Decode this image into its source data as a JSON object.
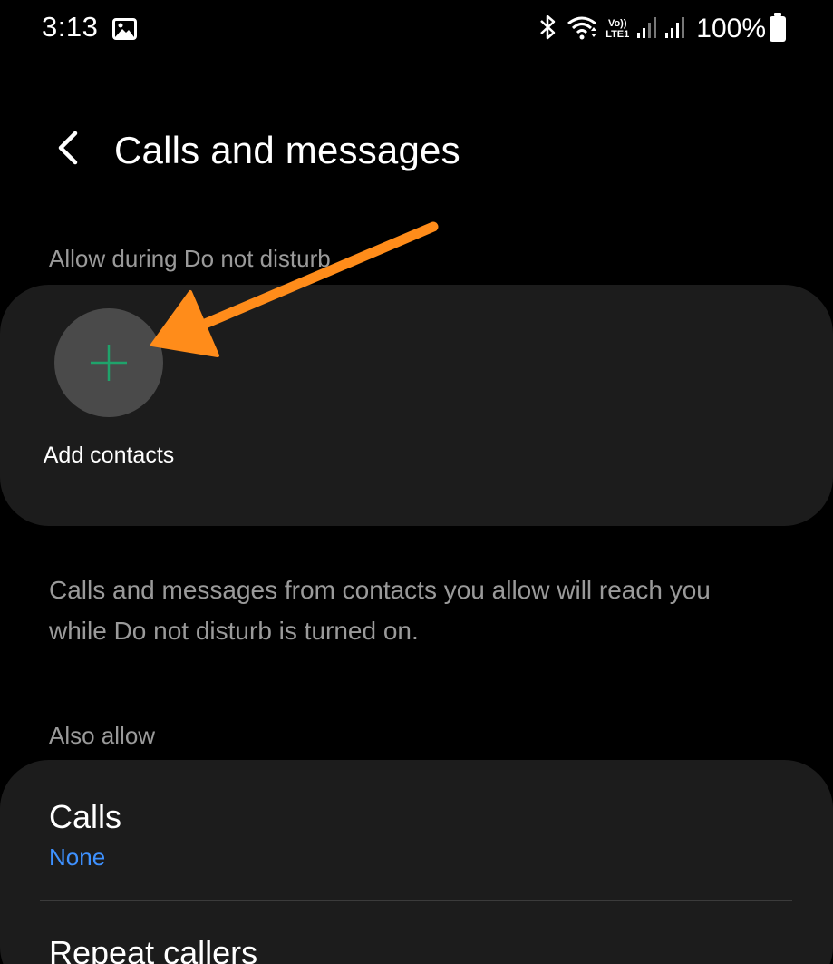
{
  "status_bar": {
    "time": "3:13",
    "network_top": "Vo))",
    "network_bottom": "LTE1",
    "battery": "100%"
  },
  "header": {
    "title": "Calls and messages"
  },
  "section_allow": {
    "label": "Allow during Do not disturb",
    "add_contacts_label": "Add contacts"
  },
  "description": "Calls and messages from contacts you allow will reach you while Do not disturb is turned on.",
  "section_also": {
    "label": "Also allow",
    "items": [
      {
        "title": "Calls",
        "subtitle": "None"
      },
      {
        "title": "Repeat callers"
      }
    ]
  },
  "colors": {
    "accent_blue": "#3e91ff",
    "plus_green": "#1fa36b",
    "annotation_orange": "#ff8c1a",
    "card_bg": "#1c1c1c"
  },
  "icons": [
    "gallery-icon",
    "bluetooth-icon",
    "wifi-icon",
    "signal-icon",
    "battery-icon",
    "back-chevron-icon",
    "plus-icon",
    "annotation-arrow"
  ]
}
